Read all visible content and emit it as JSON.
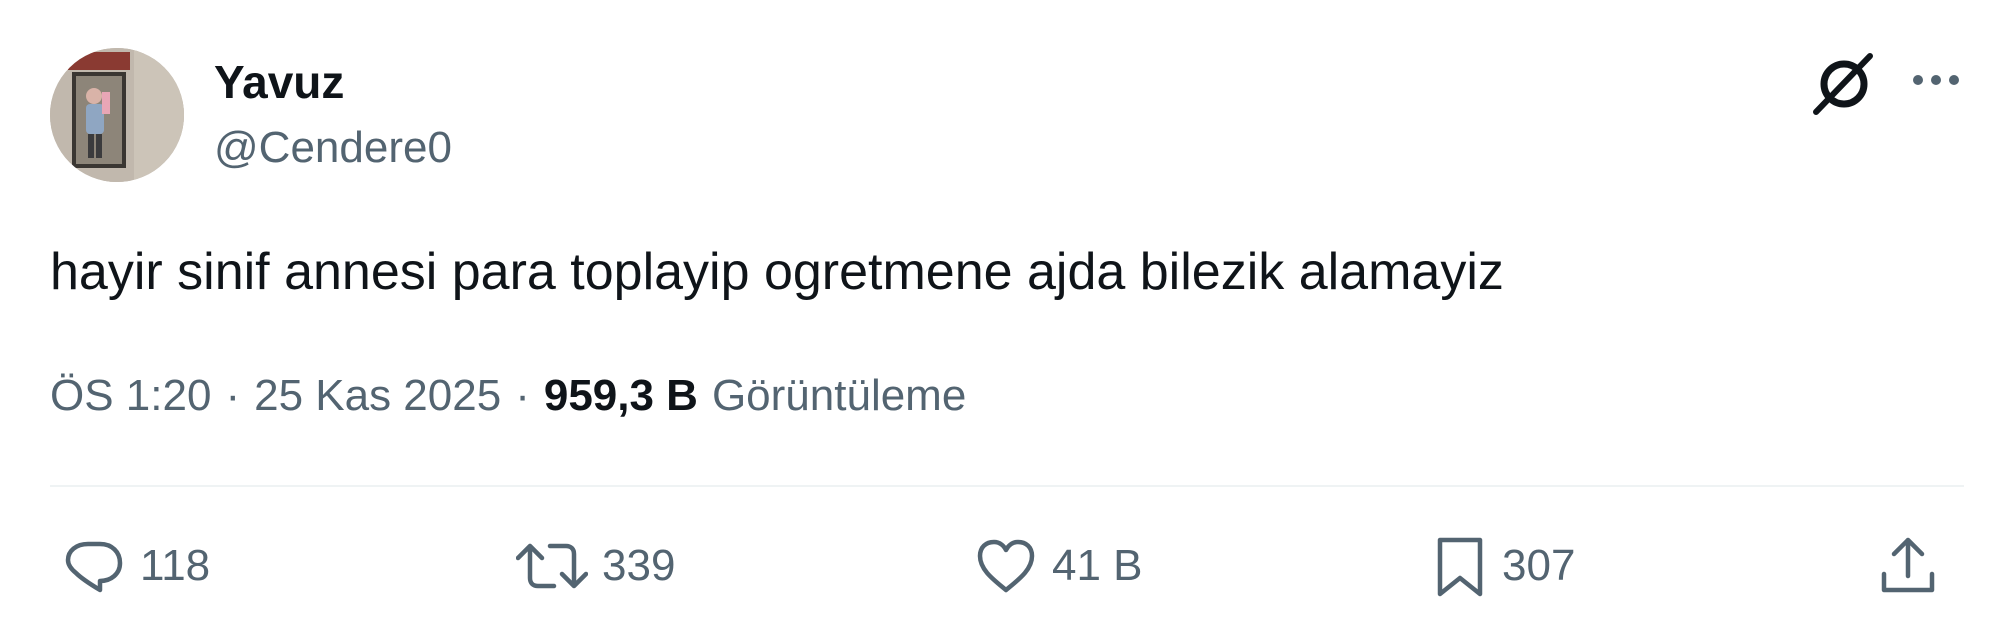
{
  "author": {
    "display_name": "Yavuz",
    "handle": "@Cendere0"
  },
  "tweet": {
    "text": "hayir sinif annesi para toplayip ogretmene ajda bilezik alamayiz"
  },
  "meta": {
    "time": "ÖS 1:20",
    "separator": "·",
    "date": "25 Kas 2025",
    "views_count": "959,3 B",
    "views_label": "Görüntüleme"
  },
  "actions": {
    "replies": "118",
    "retweets": "339",
    "likes": "41 B",
    "bookmarks": "307"
  },
  "icons": {
    "grok": "grok-icon",
    "more": "more-icon",
    "reply": "reply-icon",
    "retweet": "retweet-icon",
    "like": "heart-icon",
    "bookmark": "bookmark-icon",
    "share": "share-icon"
  },
  "colors": {
    "text_primary": "#0f1419",
    "text_secondary": "#536471",
    "divider": "#eff3f4"
  }
}
